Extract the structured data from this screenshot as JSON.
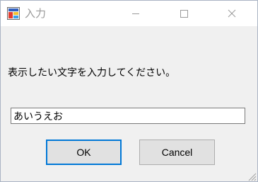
{
  "window": {
    "title": "入力",
    "icon": "app-icon",
    "controls": [
      "minimize-icon",
      "maximize-icon",
      "close-icon"
    ]
  },
  "dialog": {
    "prompt": "表示したい文字を入力してください。",
    "input_value": "あいうえお",
    "ok_label": "OK",
    "cancel_label": "Cancel"
  },
  "colors": {
    "window_background": "#f0f0f0",
    "titlebar_background": "#ffffff",
    "title_text": "#999999",
    "default_button_border": "#0078d7",
    "button_face": "#e1e1e1"
  }
}
